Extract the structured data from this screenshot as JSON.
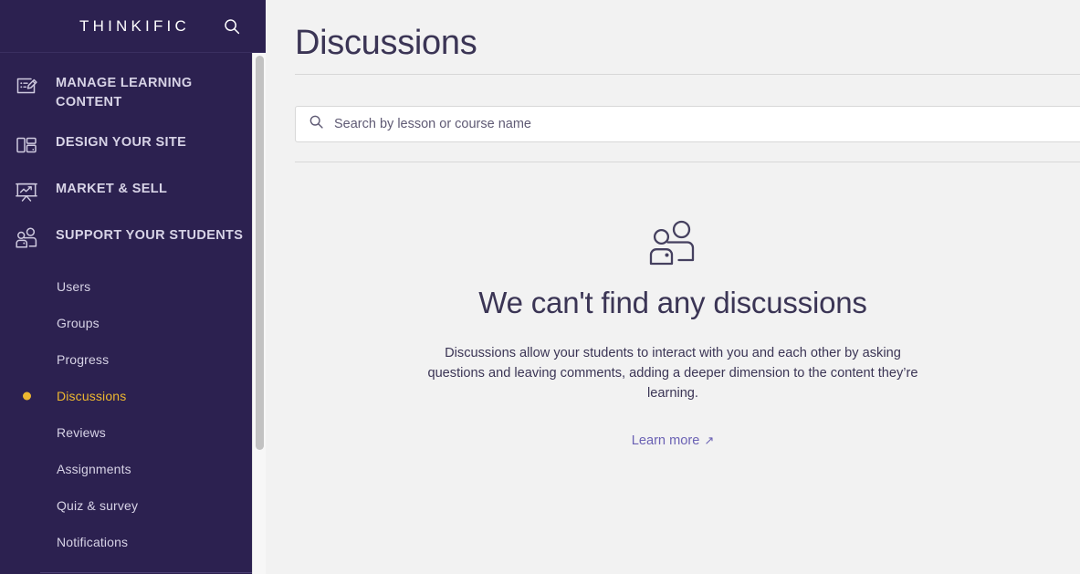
{
  "colors": {
    "sidebar_bg": "#2c2150",
    "accent_gold": "#edb730",
    "text_light": "#d7d3e6",
    "main_bg": "#f2f2f2",
    "heading": "#3b3555",
    "link": "#6b62b4"
  },
  "sidebar": {
    "brand": "THINKIFIC",
    "search_icon": "search-icon",
    "sections": [
      {
        "label": "MANAGE LEARNING CONTENT",
        "icon": "note-pencil-icon"
      },
      {
        "label": "DESIGN YOUR SITE",
        "icon": "layout-panels-icon"
      },
      {
        "label": "MARKET & SELL",
        "icon": "presentation-chart-icon"
      },
      {
        "label": "SUPPORT YOUR STUDENTS",
        "icon": "two-people-icon"
      }
    ],
    "subitems": [
      {
        "label": "Users",
        "active": false
      },
      {
        "label": "Groups",
        "active": false
      },
      {
        "label": "Progress",
        "active": false
      },
      {
        "label": "Discussions",
        "active": true
      },
      {
        "label": "Reviews",
        "active": false
      },
      {
        "label": "Assignments",
        "active": false
      },
      {
        "label": "Quiz & survey",
        "active": false
      },
      {
        "label": "Notifications",
        "active": false
      }
    ]
  },
  "main": {
    "title": "Discussions",
    "search": {
      "placeholder": "Search by lesson or course name",
      "value": "",
      "icon": "search-icon"
    },
    "empty_state": {
      "icon": "two-people-icon",
      "title": "We can't find any discussions",
      "body": "Discussions allow your students to interact with you and each other by asking questions and leaving comments, adding a deeper dimension to the content they’re learning.",
      "link_label": "Learn more",
      "link_arrow": "↗"
    }
  }
}
